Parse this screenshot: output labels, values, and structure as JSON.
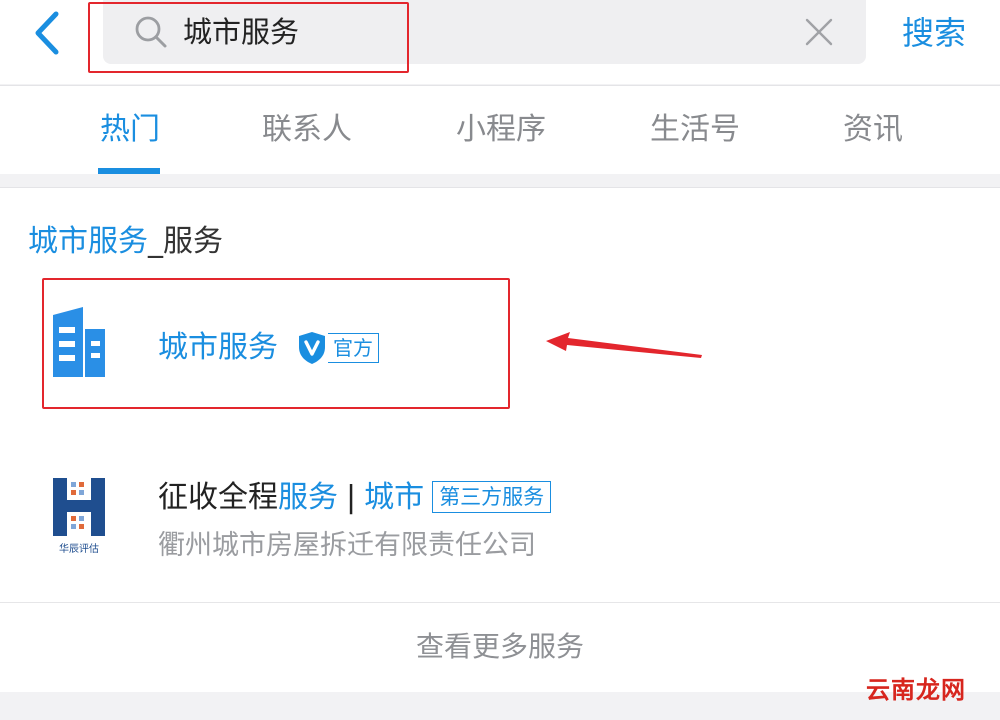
{
  "search": {
    "query": "城市服务",
    "button_label": "搜索",
    "icons": {
      "back": "chevron-left-icon",
      "search": "search-icon",
      "clear": "close-icon"
    }
  },
  "tabs": [
    {
      "label": "热门",
      "active": true
    },
    {
      "label": "联系人",
      "active": false
    },
    {
      "label": "小程序",
      "active": false
    },
    {
      "label": "生活号",
      "active": false
    },
    {
      "label": "资讯",
      "active": false
    }
  ],
  "section": {
    "keyword": "城市服务",
    "suffix": "_服务"
  },
  "results": [
    {
      "name": "城市服务",
      "badge": "官方",
      "icon": "building-icon",
      "badge_icon": "shield-v-icon"
    },
    {
      "title_parts": [
        "征收全程",
        "服务",
        "|",
        "城市"
      ],
      "badge": "第三方服务",
      "subtitle": "衢州城市房屋拆迁有限责任公司",
      "logo_text": "华辰评估",
      "icon": "huachen-logo"
    }
  ],
  "more_label": "查看更多服务",
  "watermark": "云南龙网",
  "colors": {
    "accent": "#1a8ee0",
    "highlight": "#e3262d",
    "muted": "#888a8e",
    "background": "#f2f2f4"
  }
}
